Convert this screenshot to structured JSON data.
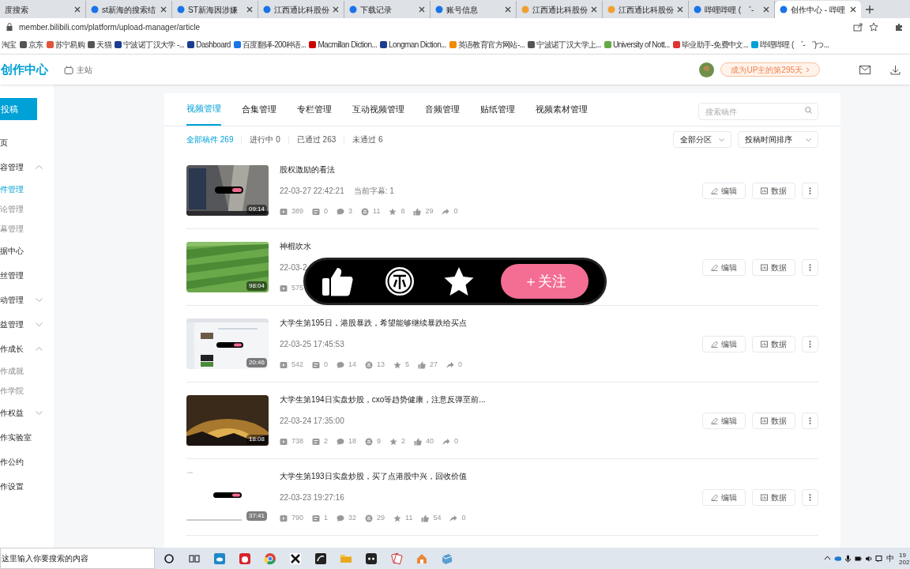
{
  "browser_tabs": [
    {
      "title": "度搜索",
      "selected": false
    },
    {
      "title": "st新海的搜索结",
      "selected": false
    },
    {
      "title": "ST新海因涉嫌",
      "selected": false
    },
    {
      "title": "江西通比科股份",
      "selected": false
    },
    {
      "title": "下载记录",
      "selected": false
    },
    {
      "title": "账号信息",
      "selected": false
    },
    {
      "title": "江西通比科股份",
      "selected": false
    },
    {
      "title": "江西通比科股份",
      "selected": false
    },
    {
      "title": "哔哩哔哩 ( ゜-",
      "selected": false
    },
    {
      "title": "创作中心 - 哔哩",
      "selected": true
    }
  ],
  "address_bar": {
    "url": "member.bilibili.com/platform/upload-manager/article"
  },
  "bookmarks": [
    "淘宝",
    "京东",
    "苏宁易购",
    "天猫",
    "宁波诺丁汉大学 -...",
    "Dashboard",
    "百度翻译-200种语...",
    "Macmillan Diction...",
    "Longman Diction...",
    "英语教育官方网站-...",
    "宁波诺丁汉大学上...",
    "University of Nott...",
    "毕业助手-免费中文...",
    "哔哩哔哩 ( ゜- ゜)つ..."
  ],
  "header": {
    "title": "创作中心",
    "home_link": "主站",
    "badge": "成为UP主的第295天"
  },
  "sidebar": {
    "upload_button": "投稿",
    "items": [
      {
        "label": "页",
        "selected": false
      },
      {
        "label": "容管理",
        "selected": false,
        "expanded": true,
        "children": [
          {
            "label": "件管理",
            "selected": true
          },
          {
            "label": "论管理",
            "selected": false
          },
          {
            "label": "幕管理",
            "selected": false
          }
        ]
      },
      {
        "label": "据中心",
        "selected": false
      },
      {
        "label": "丝管理",
        "selected": false
      },
      {
        "label": "动管理",
        "selected": false,
        "expanded": false
      },
      {
        "label": "益管理",
        "selected": false,
        "expanded": false
      },
      {
        "label": "作成长",
        "selected": false,
        "expanded": true,
        "children": [
          {
            "label": "作成就",
            "selected": false
          },
          {
            "label": "作学院",
            "selected": false
          }
        ]
      },
      {
        "label": "作权益",
        "selected": false,
        "expanded": false
      },
      {
        "label": "作实验室",
        "selected": false
      },
      {
        "label": "作公约",
        "selected": false
      },
      {
        "label": "作设置",
        "selected": false
      }
    ]
  },
  "tabs": [
    {
      "label": "视频管理",
      "selected": true
    },
    {
      "label": "合集管理",
      "selected": false
    },
    {
      "label": "专栏管理",
      "selected": false
    },
    {
      "label": "互动视频管理",
      "selected": false
    },
    {
      "label": "音频管理",
      "selected": false
    },
    {
      "label": "贴纸管理",
      "selected": false
    },
    {
      "label": "视频素材管理",
      "selected": false
    }
  ],
  "search": {
    "placeholder": "搜索稿件"
  },
  "filters": [
    {
      "label": "全部稿件 269",
      "selected": true
    },
    {
      "label": "进行中 0",
      "selected": false
    },
    {
      "label": "已通过 263",
      "selected": false
    },
    {
      "label": "未通过 6",
      "selected": false
    }
  ],
  "dropdowns": [
    "全部分区",
    "投稿时间排序"
  ],
  "videos": [
    {
      "title": "股权激励的看法",
      "duration": "09:14",
      "date": "22-03-27 22:42:21",
      "note": "当前字幕: 1",
      "stats": [
        {
          "kind": "play",
          "value": "389"
        },
        {
          "kind": "danmaku",
          "value": "0"
        },
        {
          "kind": "comment",
          "value": "3"
        },
        {
          "kind": "coin",
          "value": "11"
        },
        {
          "kind": "favorite",
          "value": "8"
        },
        {
          "kind": "like",
          "value": "29"
        },
        {
          "kind": "share",
          "value": "0"
        }
      ],
      "actions": [
        "编辑",
        "数据"
      ]
    },
    {
      "title": "神棍吹水",
      "duration": "98:04",
      "date": "22-03-2",
      "stats": [
        {
          "kind": "play",
          "value": "575"
        }
      ],
      "actions": [
        "编辑",
        "数据"
      ]
    },
    {
      "title": "大学生第195日，港股暴跌，希望能够继续暴跌给买点",
      "duration": "20:46",
      "date": "22-03-25 17:45:53",
      "stats": [
        {
          "kind": "play",
          "value": "542"
        },
        {
          "kind": "danmaku",
          "value": "0"
        },
        {
          "kind": "comment",
          "value": "14"
        },
        {
          "kind": "coin",
          "value": "13"
        },
        {
          "kind": "favorite",
          "value": "5"
        },
        {
          "kind": "like",
          "value": "27"
        },
        {
          "kind": "share",
          "value": "0"
        }
      ],
      "actions": [
        "编辑",
        "数据"
      ]
    },
    {
      "title": "大学生第194日实盘炒股，cxo等趋势健康，注意反弹至前...",
      "duration": "18:08",
      "date": "22-03-24 17:35:00",
      "stats": [
        {
          "kind": "play",
          "value": "738"
        },
        {
          "kind": "danmaku",
          "value": "2"
        },
        {
          "kind": "comment",
          "value": "18"
        },
        {
          "kind": "coin",
          "value": "9"
        },
        {
          "kind": "favorite",
          "value": "2"
        },
        {
          "kind": "like",
          "value": "40"
        },
        {
          "kind": "share",
          "value": "0"
        }
      ],
      "actions": [
        "编辑",
        "数据"
      ]
    },
    {
      "title": "大学生第193日实盘炒股，买了点港股中兴，回收价值",
      "duration": "37:41",
      "date": "22-03-23 19:27:16",
      "stats": [
        {
          "kind": "play",
          "value": "790"
        },
        {
          "kind": "danmaku",
          "value": "1"
        },
        {
          "kind": "comment",
          "value": "32"
        },
        {
          "kind": "coin",
          "value": "29"
        },
        {
          "kind": "favorite",
          "value": "11"
        },
        {
          "kind": "like",
          "value": "54"
        },
        {
          "kind": "share",
          "value": "0"
        }
      ],
      "actions": [
        "编辑",
        "数据"
      ]
    }
  ],
  "overlay": {
    "follow_button": "＋关注"
  },
  "taskbar": {
    "search_placeholder": "这里输入你要搜索的内容",
    "ime": "中",
    "clock": [
      "19",
      "202"
    ]
  }
}
